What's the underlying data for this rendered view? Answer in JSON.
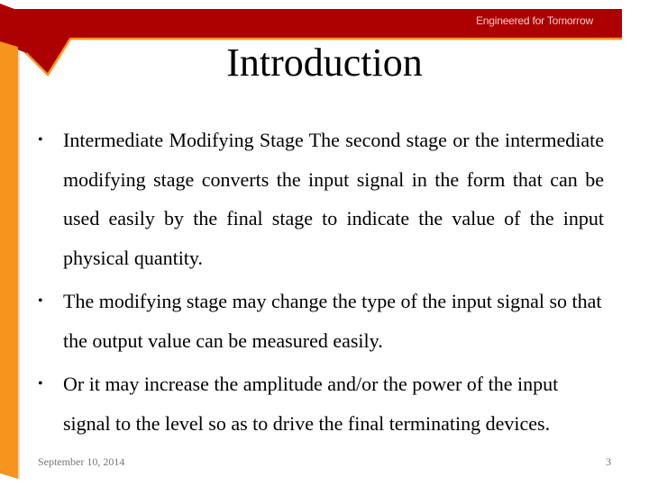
{
  "header": {
    "tagline": "Engineered for Tomorrow",
    "brand_red": "#ad0000",
    "accent_orange": "#f7941d"
  },
  "slide": {
    "title": "Introduction",
    "bullets": [
      {
        "text": "Intermediate Modifying Stage The second stage or the intermediate modifying stage converts the input signal in the form that can be used easily by the final stage to indicate the value of the input physical quantity."
      },
      {
        "text": "The modifying stage may change the type of the input signal so that the output value can be measured easily."
      },
      {
        "text": "Or it may increase the amplitude and/or the power of the input signal to the level so as to drive the final terminating devices."
      }
    ],
    "bullet_glyph": "•"
  },
  "footer": {
    "date": "September 10, 2014",
    "page_number": "3"
  }
}
